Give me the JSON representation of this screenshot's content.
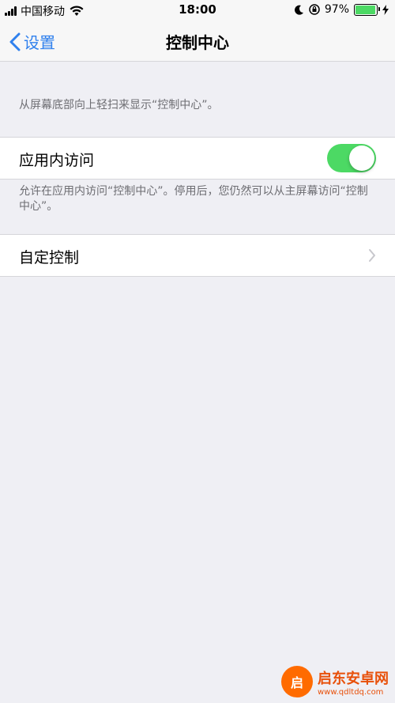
{
  "status_bar": {
    "carrier": "中国移动",
    "time": "18:00",
    "battery_percent": "97%",
    "battery_level": 0.97,
    "icons": [
      "signal-icon",
      "wifi-icon",
      "moon-icon",
      "orientation-lock-icon",
      "battery-icon",
      "charging-icon"
    ]
  },
  "nav": {
    "back_label": "设置",
    "title": "控制中心"
  },
  "intro_hint": "从屏幕底部向上轻扫来显示“控制中心”。",
  "in_app_access": {
    "label": "应用内访问",
    "enabled": true,
    "footer": "允许在应用内访问“控制中心”。停用后，您仍然可以从主屏幕访问“控制中心”。"
  },
  "customize": {
    "label": "自定控制"
  },
  "watermark": {
    "title": "启东安卓网",
    "url": "www.qdltdq.com"
  },
  "colors": {
    "accent": "#2f80ed",
    "toggle_on": "#4cd964",
    "background": "#efeff4"
  }
}
